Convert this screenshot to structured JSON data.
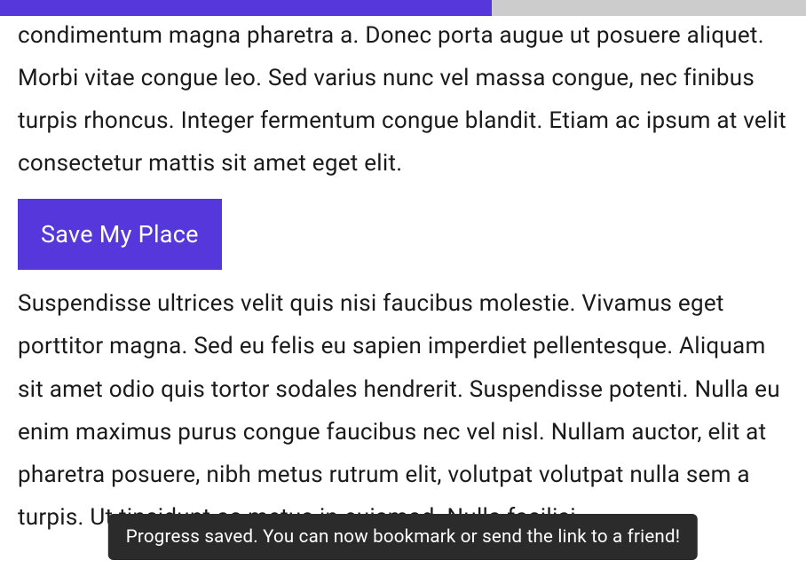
{
  "progress": {
    "percent": 61
  },
  "content": {
    "paragraph1": "condimentum magna pharetra a. Donec porta augue ut posuere aliquet. Morbi vitae congue leo. Sed varius nunc vel massa congue, nec finibus turpis rhoncus. Integer fermentum congue blandit. Etiam ac ipsum at velit consectetur mattis sit amet eget elit.",
    "paragraph2": "Suspendisse ultrices velit quis nisi faucibus molestie. Vivamus eget porttitor magna. Sed eu felis eu sapien imperdiet pellentesque. Aliquam sit amet odio quis tortor sodales hendrerit. Suspendisse potenti. Nulla eu enim maximus purus congue faucibus nec vel nisl. Nullam auctor, elit at pharetra posuere, nibh metus rutrum elit, volutpat volutpat nulla sem a turpis. Ut tincidunt ac metus in euismod. Nulla facilisi."
  },
  "button": {
    "save_label": "Save My Place"
  },
  "toast": {
    "message": "Progress saved. You can now bookmark or send the link to a friend!"
  },
  "colors": {
    "accent": "#5637db",
    "progress_bg": "#cccccc",
    "toast_bg": "#2b2b2b"
  }
}
